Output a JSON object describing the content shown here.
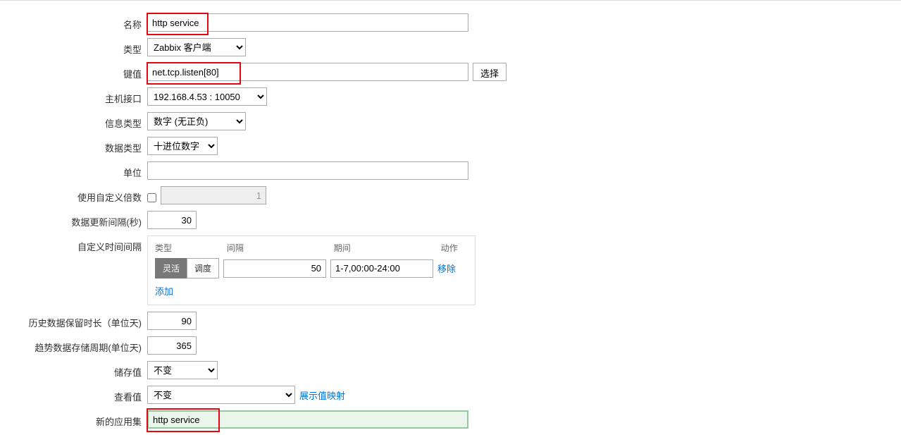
{
  "labels": {
    "name": "名称",
    "type": "类型",
    "key": "键值",
    "host_interface": "主机接口",
    "info_type": "信息类型",
    "data_type": "数据类型",
    "units": "单位",
    "custom_multiplier": "使用自定义倍数",
    "update_interval": "数据更新间隔(秒)",
    "custom_intervals": "自定义时间间隔",
    "history": "历史数据保留时长（单位天)",
    "trends": "趋势数据存储周期(单位天)",
    "store_value": "储存值",
    "show_value": "查看值",
    "new_application": "新的应用集",
    "btn_select": "选择",
    "interval_type": "类型",
    "interval_interval": "间隔",
    "interval_period": "期间",
    "interval_action": "动作",
    "btn_flexible": "灵活",
    "btn_scheduling": "调度",
    "link_remove": "移除",
    "link_add": "添加",
    "link_show_value_mappings": "展示值映射"
  },
  "values": {
    "name": "http service",
    "type": "Zabbix 客户端",
    "key": "net.tcp.listen[80]",
    "host_interface": "192.168.4.53 : 10050",
    "info_type": "数字 (无正负)",
    "data_type": "十进位数字",
    "units": "",
    "multiplier": "1",
    "update_interval": "30",
    "interval_value": "50",
    "interval_period": "1-7,00:00-24:00",
    "history": "90",
    "trends": "365",
    "store_value": "不变",
    "show_value": "不变",
    "new_application": "http service"
  }
}
